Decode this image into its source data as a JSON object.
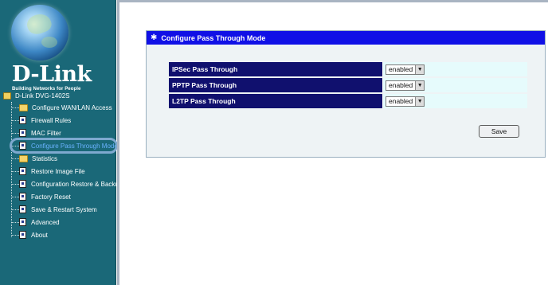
{
  "sidebar": {
    "brand": "D-Link",
    "tagline": "Building Networks for People",
    "root_label": "D-Link DVG-1402S",
    "items": [
      {
        "label": "Configure WAN/LAN Access",
        "icon": "folder-icon"
      },
      {
        "label": "Firewall Rules",
        "icon": "page-icon"
      },
      {
        "label": "MAC Filter",
        "icon": "page-icon"
      },
      {
        "label": "Configure Pass Through Mode",
        "icon": "page-icon",
        "active": true
      },
      {
        "label": "Statistics",
        "icon": "folder-icon"
      },
      {
        "label": "Restore Image File",
        "icon": "page-icon"
      },
      {
        "label": "Configuration Restore & Backup",
        "icon": "page-icon"
      },
      {
        "label": "Factory Reset",
        "icon": "page-icon"
      },
      {
        "label": "Save & Restart System",
        "icon": "page-icon"
      },
      {
        "label": "Advanced",
        "icon": "page-icon"
      },
      {
        "label": "About",
        "icon": "page-icon"
      }
    ]
  },
  "panel": {
    "title": "Configure Pass Through Mode",
    "rows": [
      {
        "label": "IPSec Pass Through",
        "value": "enabled"
      },
      {
        "label": "PPTP Pass Through",
        "value": "enabled"
      },
      {
        "label": "L2TP Pass Through",
        "value": "enabled"
      }
    ],
    "save_label": "Save"
  },
  "colors": {
    "sidebar_bg": "#1a6878",
    "title_bar": "#1010e6",
    "row_label_bg": "#10106e",
    "row_value_bg": "#e6fbfc",
    "active_item": "#6ab2ff"
  }
}
